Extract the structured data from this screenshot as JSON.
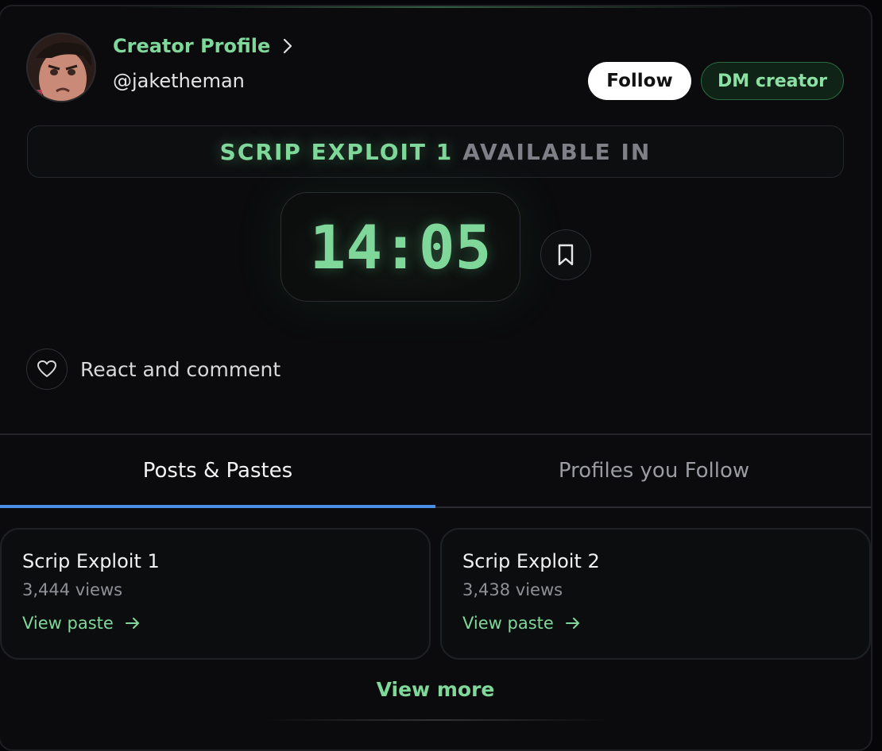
{
  "header": {
    "creator_link_label": "Creator Profile",
    "handle": "@jaketheman",
    "follow_label": "Follow",
    "dm_label": "DM creator"
  },
  "availability": {
    "item_name": "SCRIP EXPLOIT 1",
    "suffix": "AVAILABLE IN"
  },
  "countdown": {
    "time": "14:05"
  },
  "react": {
    "label": "React and comment"
  },
  "tabs": [
    {
      "label": "Posts & Pastes",
      "active": true
    },
    {
      "label": "Profiles you Follow",
      "active": false
    }
  ],
  "posts": [
    {
      "title": "Scrip Exploit 1",
      "views": "3,444 views",
      "link_label": "View paste"
    },
    {
      "title": "Scrip Exploit 2",
      "views": "3,438 views",
      "link_label": "View paste"
    }
  ],
  "view_more_label": "View more",
  "icons": {
    "creator_chevron": "chevron-right-icon",
    "bookmark": "bookmark-icon",
    "react": "heart-icon",
    "post_link": "arrow-right-icon"
  },
  "colors": {
    "accent_green": "#7fd89a",
    "tab_indicator": "#4a8ee6",
    "background": "#0b0b0d"
  }
}
